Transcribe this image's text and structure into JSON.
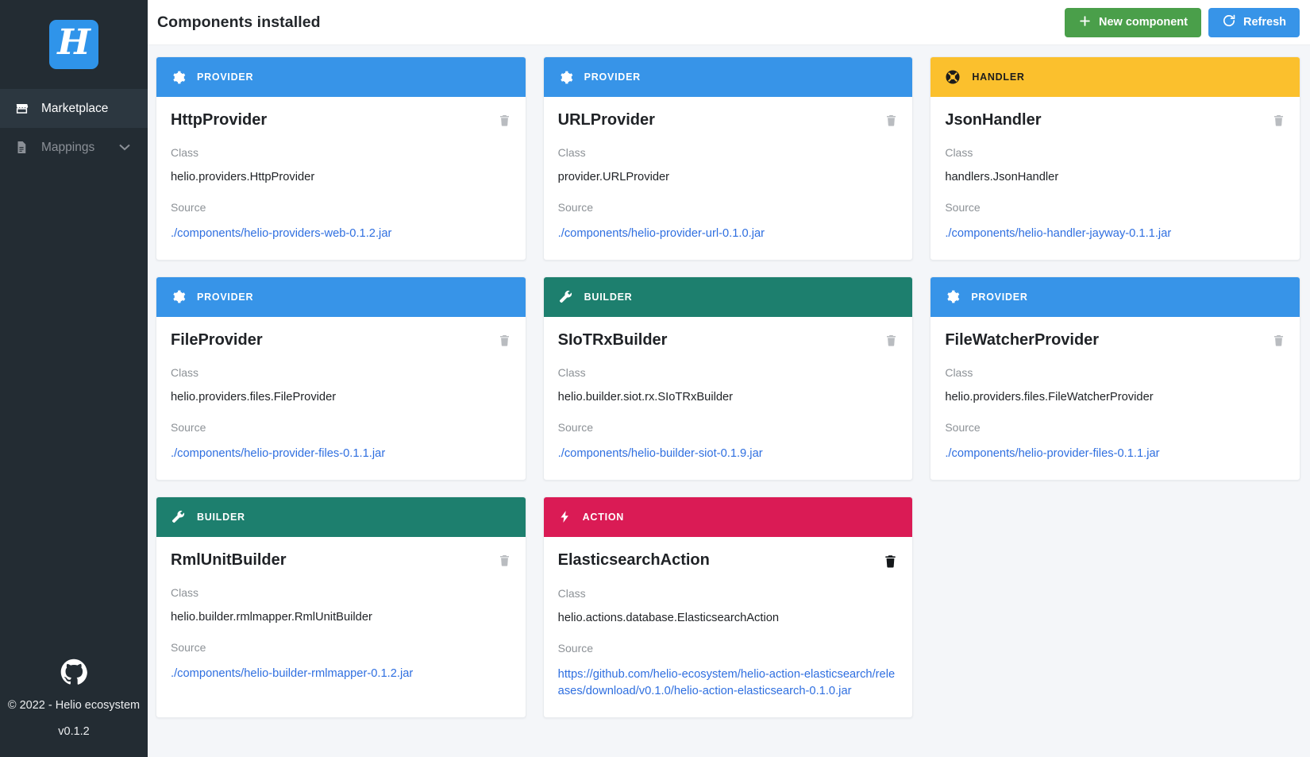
{
  "sidebar": {
    "logo_letter": "H",
    "items": [
      {
        "label": "Marketplace",
        "icon": "storefront-icon",
        "active": true
      },
      {
        "label": "Mappings",
        "icon": "document-icon",
        "active": false,
        "chevron": "⌄"
      }
    ],
    "footer": {
      "github_icon": "github-icon",
      "copyright": "© 2022 - Helio ecosystem",
      "version": "v0.1.2"
    }
  },
  "header": {
    "title": "Components installed",
    "new_component_label": "New component",
    "new_component_icon": "plus-icon",
    "refresh_label": "Refresh",
    "refresh_icon": "refresh-icon",
    "new_component_color": "#4a9f4a",
    "refresh_color": "#3794e8"
  },
  "labels": {
    "class": "Class",
    "source": "Source",
    "delete_icon": "trash-icon"
  },
  "kind_colors": {
    "PROVIDER": "#3794e8",
    "HANDLER": "#fbc02d",
    "BUILDER": "#1d7f6e",
    "ACTION": "#da1b55"
  },
  "components": [
    {
      "kind": "PROVIDER",
      "kind_icon": "gear-icon",
      "name": "HttpProvider",
      "class": "helio.providers.HttpProvider",
      "source": "./components/helio-providers-web-0.1.2.jar"
    },
    {
      "kind": "PROVIDER",
      "kind_icon": "gear-icon",
      "name": "URLProvider",
      "class": "provider.URLProvider",
      "source": "./components/helio-provider-url-0.1.0.jar"
    },
    {
      "kind": "HANDLER",
      "kind_icon": "lifebuoy-icon",
      "name": "JsonHandler",
      "class": "handlers.JsonHandler",
      "source": "./components/helio-handler-jayway-0.1.1.jar"
    },
    {
      "kind": "PROVIDER",
      "kind_icon": "gear-icon",
      "name": "FileProvider",
      "class": "helio.providers.files.FileProvider",
      "source": "./components/helio-provider-files-0.1.1.jar"
    },
    {
      "kind": "BUILDER",
      "kind_icon": "wrench-icon",
      "name": "SIoTRxBuilder",
      "class": "helio.builder.siot.rx.SIoTRxBuilder",
      "source": "./components/helio-builder-siot-0.1.9.jar"
    },
    {
      "kind": "PROVIDER",
      "kind_icon": "gear-icon",
      "name": "FileWatcherProvider",
      "class": "helio.providers.files.FileWatcherProvider",
      "source": "./components/helio-provider-files-0.1.1.jar"
    },
    {
      "kind": "BUILDER",
      "kind_icon": "wrench-icon",
      "name": "RmlUnitBuilder",
      "class": "helio.builder.rmlmapper.RmlUnitBuilder",
      "source": "./components/helio-builder-rmlmapper-0.1.2.jar"
    },
    {
      "kind": "ACTION",
      "kind_icon": "bolt-icon",
      "name": "ElasticsearchAction",
      "class": "helio.actions.database.ElasticsearchAction",
      "source": "https://github.com/helio-ecosystem/helio-action-elasticsearch/releases/download/v0.1.0/helio-action-elasticsearch-0.1.0.jar"
    }
  ]
}
